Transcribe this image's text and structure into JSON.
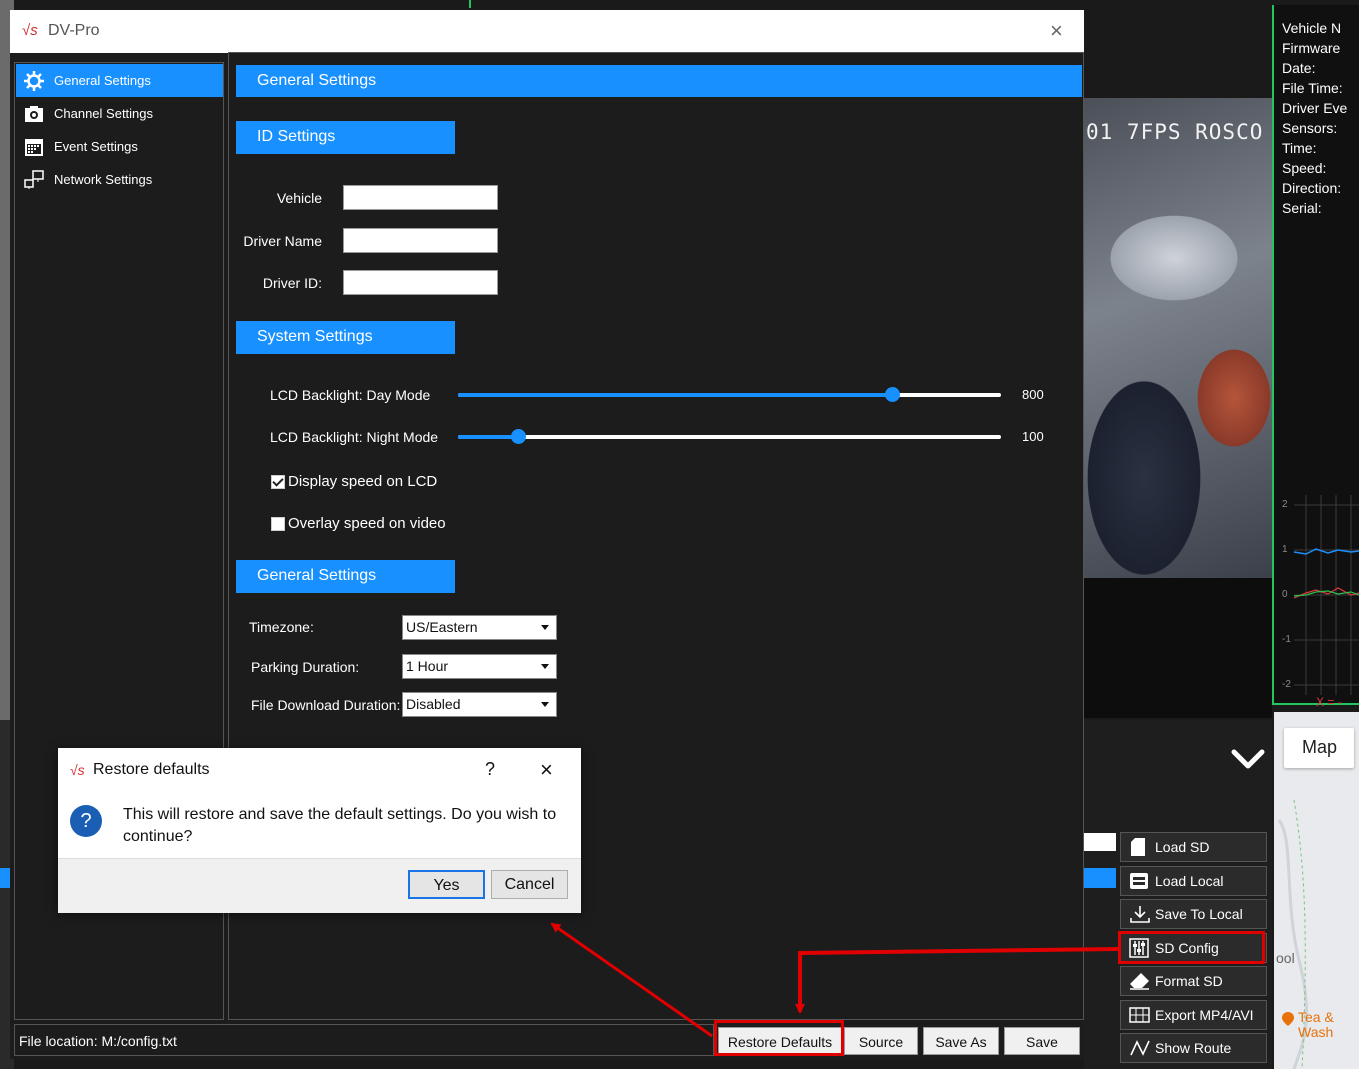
{
  "background": {
    "video_overlay": "01 7FPS ROSCO",
    "info_labels": [
      "Vehicle N",
      "Firmware",
      "Date:",
      "File Time:",
      "Driver Eve",
      "Sensors:",
      "Time:",
      "Speed:",
      "Direction:",
      "Serial:"
    ],
    "graph_ticks": [
      "2",
      "1",
      "0",
      "-1",
      "-2"
    ],
    "graph_x_label": "X = -",
    "map_button": "Map",
    "map_place_fragment": "ool",
    "map_poi": [
      "Tea &",
      "Wash"
    ],
    "side_buttons": [
      {
        "label": "Load SD",
        "icon": "sd-card-icon"
      },
      {
        "label": "Load Local",
        "icon": "folder-icon"
      },
      {
        "label": "Save To Local",
        "icon": "download-icon"
      },
      {
        "label": "SD Config",
        "icon": "sd-config-icon"
      },
      {
        "label": "Format SD",
        "icon": "eraser-icon"
      },
      {
        "label": "Export MP4/AVI",
        "icon": "film-icon"
      },
      {
        "label": "Show Route",
        "icon": "route-icon"
      }
    ]
  },
  "window": {
    "logo": "√s",
    "title": "DV-Pro",
    "close": "×"
  },
  "sidebar": {
    "items": [
      {
        "label": "General Settings",
        "icon": "gear-icon",
        "active": true
      },
      {
        "label": "Channel Settings",
        "icon": "camera-icon",
        "active": false
      },
      {
        "label": "Event Settings",
        "icon": "calendar-icon",
        "active": false
      },
      {
        "label": "Network Settings",
        "icon": "network-icon",
        "active": false
      }
    ]
  },
  "content": {
    "header": "General Settings",
    "id_settings": {
      "header": "ID Settings",
      "vehicle_label": "Vehicle",
      "vehicle_value": "",
      "driver_name_label": "Driver Name",
      "driver_name_value": "",
      "driver_id_label": "Driver ID:",
      "driver_id_value": ""
    },
    "system_settings": {
      "header": "System Settings",
      "day_label": "LCD Backlight: Day Mode",
      "day_value": "800",
      "day_fraction": 0.8,
      "night_label": "LCD Backlight: Night Mode",
      "night_value": "100",
      "night_fraction": 0.11,
      "display_speed_label": "Display speed on LCD",
      "display_speed_checked": true,
      "overlay_speed_label": "Overlay speed on video",
      "overlay_speed_checked": false
    },
    "general_settings": {
      "header": "General Settings",
      "timezone_label": "Timezone:",
      "timezone_value": "US/Eastern",
      "parking_label": "Parking Duration:",
      "parking_value": "1 Hour",
      "download_label": "File Download Duration:",
      "download_value": "Disabled"
    }
  },
  "footer": {
    "file_location": "File location: M:/config.txt",
    "restore_label": "Restore Defaults",
    "source_label": "Source",
    "save_as_label": "Save As",
    "save_label": "Save"
  },
  "dialog": {
    "logo": "√s",
    "title": "Restore defaults",
    "help": "?",
    "close": "×",
    "icon": "?",
    "message": "This will restore and save the default settings. Do you wish to continue?",
    "yes_label": "Yes",
    "cancel_label": "Cancel"
  },
  "colors": {
    "accent": "#1890ff",
    "highlight": "#e10000",
    "frame_green": "#22c55e"
  }
}
